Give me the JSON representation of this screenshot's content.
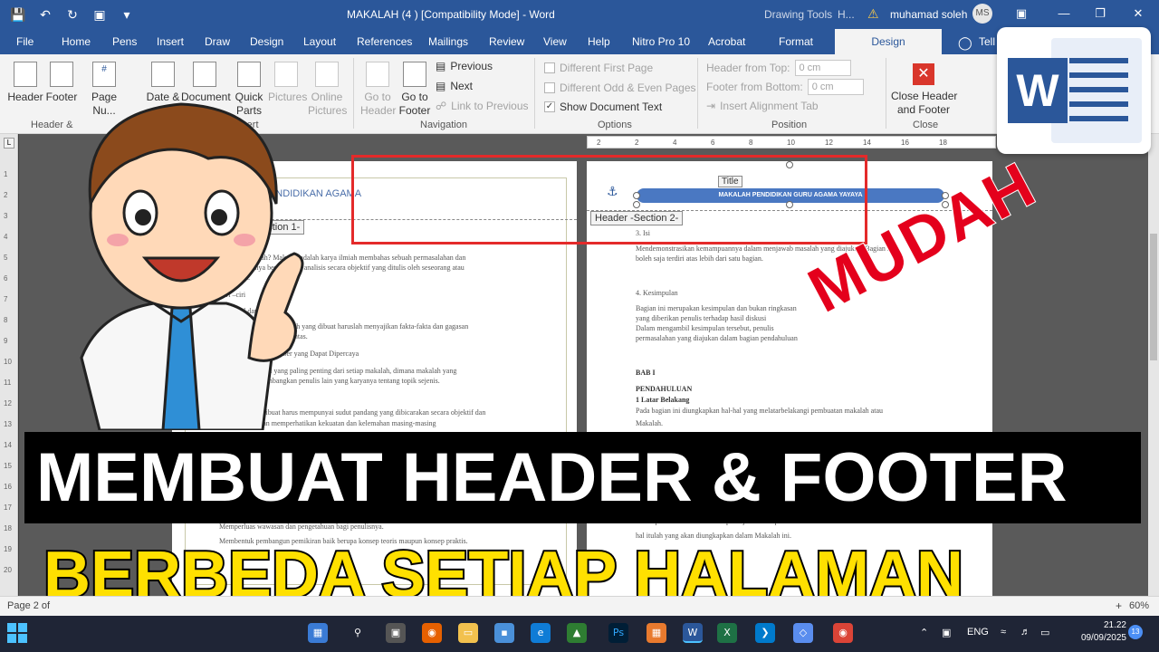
{
  "titlebar": {
    "doc_title": "MAKALAH  (4 ) [Compatibility Mode]  -  Word",
    "context_label": "Drawing Tools",
    "context_label2": "H...",
    "user_name": "muhamad soleh",
    "user_initials": "MS"
  },
  "tabs": [
    "File",
    "Home",
    "Pens",
    "Insert",
    "Draw",
    "Design",
    "Layout",
    "References",
    "Mailings",
    "Review",
    "View",
    "Help",
    "Nitro Pro 10",
    "Acrobat",
    "Format",
    "Design",
    "Tell"
  ],
  "ribbon": {
    "header": "Header",
    "footer": "Footer",
    "page_number": "Page\nNu...",
    "date_time": "Date &",
    "document_info": "Document\nInfo",
    "quick_parts": "Quick\nParts",
    "pictures": "Pictures",
    "online_pictures": "Online\nPictures",
    "go_to_header": "Go to\nHeader",
    "go_to_footer": "Go to\nFooter",
    "previous": "Previous",
    "next": "Next",
    "link_to_previous": "Link to Previous",
    "different_first_page": "Different First Page",
    "different_odd_even": "Different Odd & Even Pages",
    "show_document_text": "Show Document Text",
    "header_from_top": "Header from Top:",
    "footer_from_bottom": "Footer from Bottom:",
    "header_from_top_value": "0 cm",
    "footer_from_bottom_value": "0 cm",
    "insert_alignment_tab": "Insert Alignment Tab",
    "close_header_footer": "Close Header\nand Footer",
    "groups": {
      "header_footer": "Header &",
      "insert": "Insert",
      "navigation": "Navigation",
      "options": "Options",
      "position": "Position",
      "close": "Close"
    }
  },
  "page1": {
    "header_text": "MAKALAH PENDIDIKAN AGAMA",
    "header_tag": "Header -Section 1-",
    "lines": [
      {
        "t": "MAKALAH",
        "b": true
      },
      {
        "t": "Apa itu Makalah? Makalah adalah karya ilmiah membahas sebuah permasalahan dan"
      },
      {
        "t": "pembahasannya berdasarkan analisis secara objektif yang ditulis oleh seseorang atau"
      },
      {
        "t": "kelompok."
      },
      {
        "t": "Ciri –ciri"
      },
      {
        "t": "1.  Aktual dan Faktual"
      },
      {
        "t": "Maksudnya adalah makalah yang dibuat haruslah menyajikan fakta-fakta dan gagasan"
      },
      {
        "t": "yang akurat, aktual dan tuntas."
      },
      {
        "t": "2.  Menggunakan Sumber yang Dapat Dipercaya"
      },
      {
        "t": "Ciri ini adalah ciri yang paling penting dari setiap makalah, dimana makalah yang"
      },
      {
        "t": "ditulis mempertimbangkan penulis lain yang karyanya tentang topik sejenis."
      },
      {
        "t": "Makalah yang dibuat harus mempunyai sudut pandang yang dibicarakan secara objektif dan"
      },
      {
        "t": "seimbang dengan memperhatikan kekuatan dan kelemahan masing-masing"
      },
      {
        "t": "Memperluas wawasan dan pengetahuan bagi penulisnya."
      },
      {
        "t": "Membentuk pembangun pemikiran baik berupa konsep teoris maupun konsep praktis."
      }
    ]
  },
  "page2": {
    "title_tag": "Title",
    "title_text": "MAKALAH PENDIDIKAN GURU AGAMA YAYAYA",
    "header_tag": "Header -Section 2-",
    "lines": [
      {
        "t": "3. Isi"
      },
      {
        "t": "Mendemonstrasikan kemampuannya dalam menjawab masalah yang diajukan. Bagian ini"
      },
      {
        "t": "boleh saja terdiri atas lebih dari satu bagian."
      },
      {
        "t": "4. Kesimpulan"
      },
      {
        "t": "Bagian ini merupakan kesimpulan dan bukan ringkasan"
      },
      {
        "t": "yang diberikan penulis terhadap hasil diskusi"
      },
      {
        "t": "Dalam mengambil kesimpulan tersebut, penulis"
      },
      {
        "t": "permasalahan yang diajukan dalam bagian pendahuluan"
      },
      {
        "t": "BAB I",
        "b": true
      },
      {
        "t": "PENDAHULUAN",
        "b": true
      },
      {
        "t": "1 Latar Belakang",
        "b": true
      },
      {
        "t": "Pada bagian ini diungkapkan hal-hal yang melatarbelakangi pembuatan makalah atau"
      },
      {
        "t": "Makalah."
      },
      {
        "t": "dalam pemahaman dalam. Sampai sejauh mana pemahaman untuk di Indonesia dilaksanakan."
      },
      {
        "t": "hal itulah yang akan diungkapkan dalam Makalah ini."
      }
    ]
  },
  "ruler_numbers": [
    "2",
    "2",
    "4",
    "6",
    "8",
    "10",
    "12",
    "14",
    "16",
    "18"
  ],
  "line_numbers": [
    "1",
    "2",
    "3",
    "4",
    "5",
    "6",
    "7",
    "8",
    "9",
    "10",
    "11",
    "12",
    "13",
    "14",
    "15",
    "16",
    "17",
    "18",
    "19",
    "20"
  ],
  "overlay": {
    "mudah": "MUDAH",
    "banner1": "MEMBUAT HEADER & FOOTER",
    "banner2": "BERBEDA SETIAP HALAMAN"
  },
  "status": {
    "page": "Page 2 of",
    "zoom": "60%"
  },
  "taskbar": {
    "lang": "ENG",
    "time": "21.22",
    "date": "09/09/2025",
    "notifications": "13"
  },
  "colors": {
    "word_blue": "#2b579a",
    "highlight_red": "#e42a2a",
    "mudah_red": "#e4001c",
    "banner_yellow": "#ffe000"
  }
}
